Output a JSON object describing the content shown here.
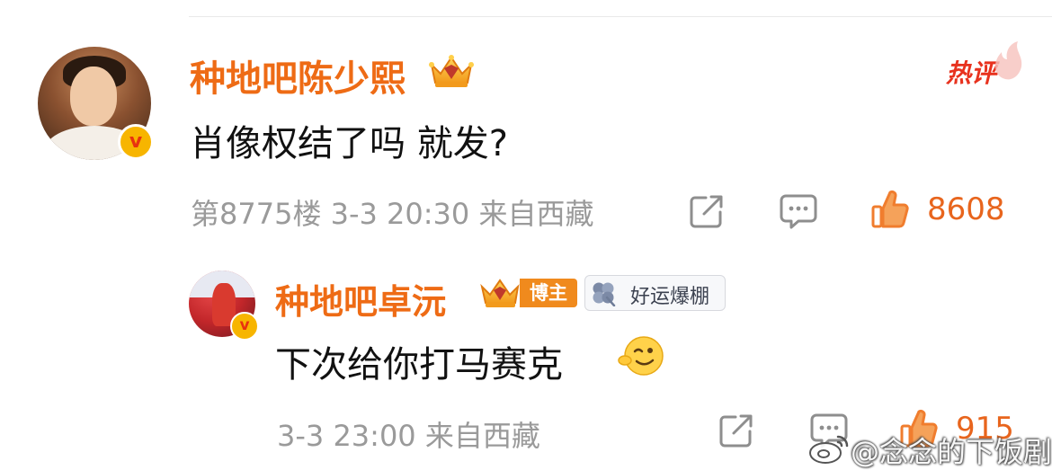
{
  "main_comment": {
    "username": "种地吧陈少熙",
    "hot_label": "热评",
    "text": "肖像权结了吗 就发?",
    "meta": "第8775楼 3-3 20:30 来自西藏",
    "like_count": "8608",
    "icons": [
      "share-icon",
      "comment-icon",
      "thumbs-up-icon",
      "crown-icon",
      "verified-v-icon"
    ]
  },
  "reply": {
    "username": "种地吧卓沅",
    "author_tag": "博主",
    "luck_tag": "好运爆棚",
    "text": "下次给你打马赛克",
    "meta": "3-3 23:00 来自西藏",
    "like_count": "915",
    "icons": [
      "share-icon",
      "comment-icon",
      "thumbs-up-icon",
      "crown-icon",
      "clover-icon",
      "wink-emoji-icon"
    ]
  },
  "watermark": {
    "text": "@念念的下饭剧"
  },
  "colors": {
    "username": "#ee6b15",
    "like_count": "#e8651d",
    "hot": "#e8321e",
    "meta": "#9a9a9a",
    "verified_badge": "#f7b500"
  }
}
